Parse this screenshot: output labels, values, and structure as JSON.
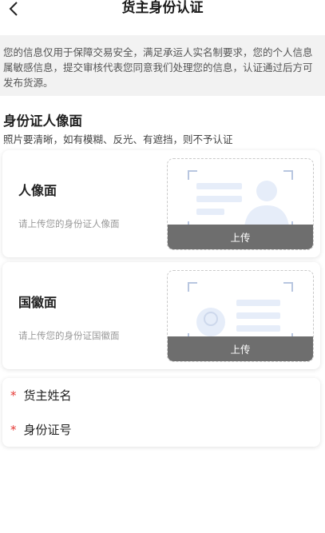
{
  "header": {
    "title": "货主身份认证"
  },
  "notice": {
    "text": "您的信息仅用于保障交易安全，满足承运人实名制要求，您的个人信息属敏感信息，提交审核代表您同意我们处理您的信息，认证通过后方可发布货源。"
  },
  "section": {
    "title": "身份证人像面",
    "subtitle": "照片要清晰，如有模糊、反光、有遮挡，则不予认证"
  },
  "cards": [
    {
      "title": "人像面",
      "hint": "请上传您的身份证人像面",
      "upload_label": "上传"
    },
    {
      "title": "国徽面",
      "hint": "请上传您的身份证国徽面",
      "upload_label": "上传"
    }
  ],
  "form": {
    "required_mark": "*",
    "fields": [
      {
        "label": "货主姓名"
      },
      {
        "label": "身份证号"
      }
    ]
  },
  "colors": {
    "accent_light": "#e6edf9",
    "required": "#e53935",
    "upload_bar": "#6e6e6e"
  }
}
